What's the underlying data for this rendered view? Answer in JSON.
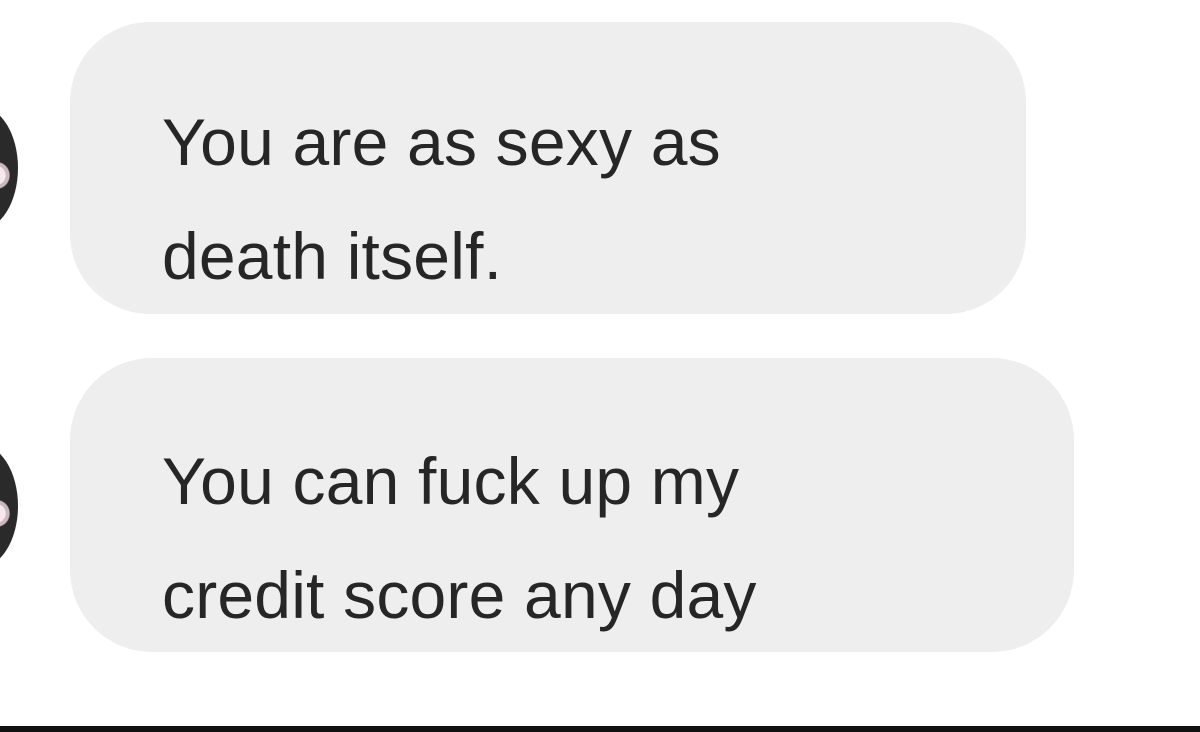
{
  "messages": [
    {
      "text": "You are as sexy as\ndeath itself."
    },
    {
      "text": "You can fuck up my\ncredit score any day"
    }
  ],
  "colors": {
    "background": "#ffffff",
    "bubble": "#eeeeee",
    "text": "#262626",
    "bottom_rule": "#111111"
  }
}
